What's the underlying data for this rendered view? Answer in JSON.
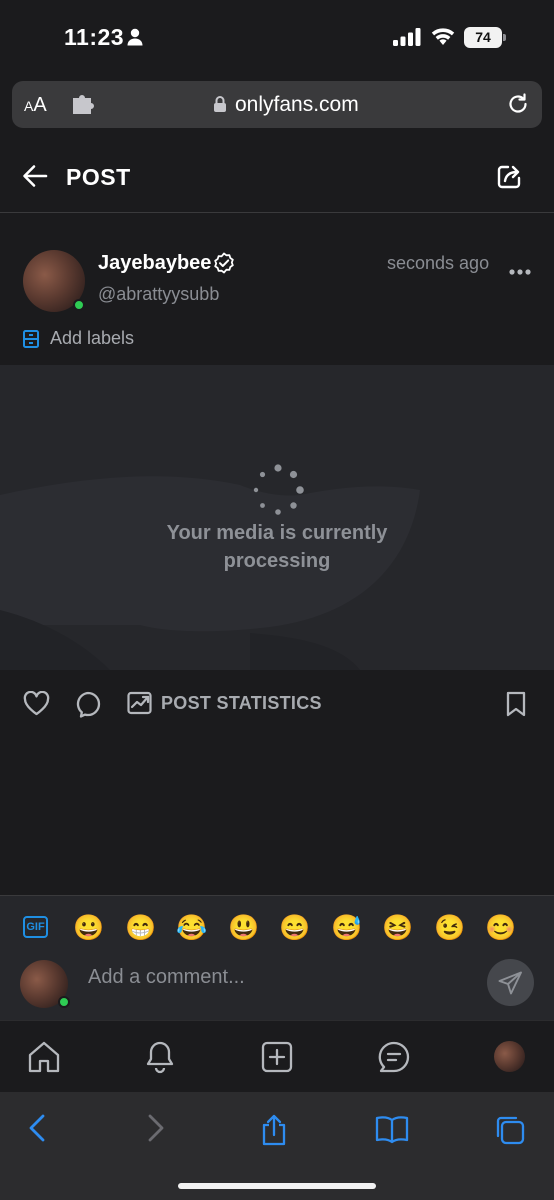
{
  "status_bar": {
    "time": "11:23",
    "battery": "74"
  },
  "browser": {
    "text_size_label": "AA",
    "domain": "onlyfans.com"
  },
  "header": {
    "title": "POST"
  },
  "post": {
    "author_name": "Jayebaybee",
    "handle": "@abrattyysubb",
    "posted": "seconds ago",
    "add_labels": "Add labels",
    "media_status_line1": "Your media is currently",
    "media_status_line2": "processing"
  },
  "actions": {
    "stats_label": "POST STATISTICS"
  },
  "composer": {
    "gif_label": "GIF",
    "emojis": [
      "😀",
      "😁",
      "😂",
      "😃",
      "😄",
      "😅",
      "😆",
      "😉",
      "😊"
    ],
    "placeholder": "Add a comment..."
  },
  "colors": {
    "accent": "#1f8fe3",
    "online": "#2fcc54",
    "muted": "#8a8d93",
    "background": "#1b1b1d"
  },
  "icons": {
    "header": [
      "back-arrow-icon",
      "share-icon"
    ],
    "actions": [
      "heart-icon",
      "comment-icon",
      "statistics-icon",
      "bookmark-icon"
    ],
    "bottom_nav": [
      "home-icon",
      "bell-icon",
      "plus-square-icon",
      "messages-icon",
      "profile-avatar"
    ],
    "safari": [
      "back-chevron-icon",
      "forward-chevron-icon",
      "share-icon",
      "bookmarks-icon",
      "tabs-icon"
    ]
  }
}
